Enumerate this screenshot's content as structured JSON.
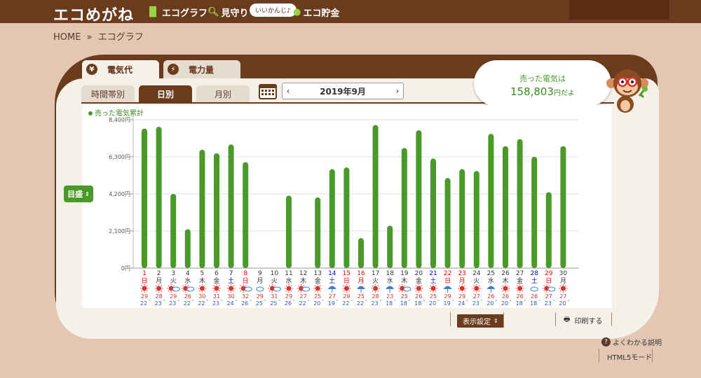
{
  "header": {
    "logo": "エコめがね",
    "nav": [
      {
        "label": "エコグラフ",
        "icon": "bar-chart-icon"
      },
      {
        "label": "見守り",
        "icon": "magnifier-icon"
      },
      {
        "label": "エコ貯金",
        "icon": "coin-icon"
      }
    ],
    "bubble": "いいかんじ♪"
  },
  "breadcrumb": {
    "home": "HOME",
    "sep": "»",
    "current": "エコグラフ"
  },
  "tabs": {
    "primary": [
      "電気代",
      "電力量"
    ],
    "primary_icons": [
      "¥",
      "⚡"
    ],
    "sub": [
      "時間帯別",
      "日別",
      "月別"
    ]
  },
  "date": {
    "label": "2019年9月",
    "prev": "‹",
    "next": "›"
  },
  "sold": {
    "line1": "売った電気は",
    "amount": "158,803",
    "suffix": "円だよ"
  },
  "legend": "売った電気累計",
  "scale_button": "目盛",
  "buttons": {
    "display_settings": "表示設定",
    "print": "印刷する",
    "help": "よくわかる説明",
    "html5": "HTML5モード"
  },
  "chart_data": {
    "type": "bar",
    "ylabel_ticks": [
      "8,400円",
      "6,300円",
      "4,200円",
      "2,100円",
      "0円"
    ],
    "ylim": [
      0,
      8400
    ],
    "days": [
      "1",
      "2",
      "3",
      "4",
      "5",
      "6",
      "7",
      "8",
      "9",
      "10",
      "11",
      "12",
      "13",
      "14",
      "15",
      "16",
      "17",
      "18",
      "19",
      "20",
      "21",
      "22",
      "23",
      "24",
      "25",
      "26",
      "27",
      "28",
      "29",
      "30"
    ],
    "weekdays": [
      "日",
      "月",
      "火",
      "水",
      "木",
      "金",
      "土",
      "日",
      "月",
      "火",
      "水",
      "木",
      "金",
      "土",
      "日",
      "月",
      "火",
      "水",
      "木",
      "金",
      "土",
      "日",
      "月",
      "火",
      "水",
      "木",
      "金",
      "土",
      "日",
      "月"
    ],
    "day_colors": [
      "red",
      "#333",
      "#333",
      "#333",
      "#333",
      "#333",
      "blue",
      "red",
      "#333",
      "#333",
      "#333",
      "#333",
      "#333",
      "blue",
      "red",
      "red",
      "#333",
      "#333",
      "#333",
      "#333",
      "blue",
      "red",
      "red",
      "#333",
      "#333",
      "#333",
      "#333",
      "blue",
      "red",
      "#333"
    ],
    "values": [
      7900,
      8000,
      4200,
      2200,
      6700,
      6500,
      7000,
      6000,
      0,
      0,
      4100,
      0,
      4000,
      5600,
      5700,
      1700,
      8100,
      2400,
      6800,
      7800,
      6200,
      5100,
      5600,
      5500,
      7600,
      6900,
      7300,
      6300,
      4300,
      6900
    ],
    "weather": [
      "sun",
      "sun",
      "sun-cloud",
      "sun-cloud",
      "sun",
      "sun",
      "sun",
      "sun-cloud",
      "cloud",
      "sun-cloud",
      "sun",
      "sun-cloud",
      "sun",
      "umbrella",
      "sun",
      "umbrella",
      "sun",
      "umbrella",
      "sun-cloud",
      "sun",
      "sun",
      "umbrella",
      "sun",
      "sun",
      "umbrella",
      "sun",
      "sun",
      "cloud",
      "sun-cloud",
      "sun"
    ],
    "high_temps": [
      "29",
      "28",
      "29",
      "26",
      "30",
      "31",
      "30",
      "32",
      "29",
      "31",
      "29",
      "27",
      "25",
      "27",
      "29",
      "25",
      "28",
      "23",
      "25",
      "26",
      "25",
      "29",
      "29",
      "27",
      "26",
      "26",
      "26",
      "26",
      "27",
      "27"
    ],
    "low_temps": [
      "22",
      "23",
      "23",
      "22",
      "22",
      "23",
      "24",
      "26",
      "25",
      "25",
      "26",
      "22",
      "20",
      "19",
      "22",
      "22",
      "23",
      "18",
      "18",
      "18",
      "20",
      "19",
      "24",
      "23",
      "20",
      "20",
      "18",
      "18",
      "23",
      "20"
    ]
  }
}
